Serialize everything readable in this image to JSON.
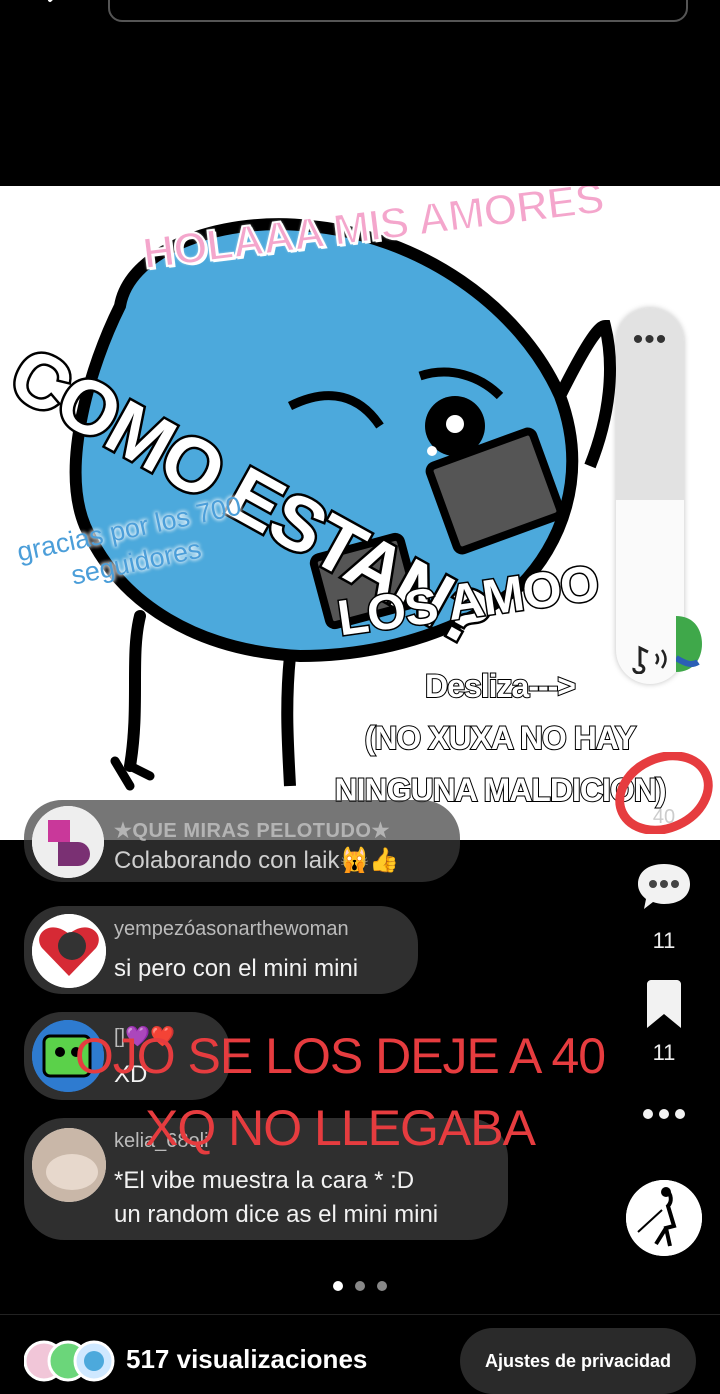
{
  "header": {
    "search_placeholder": ""
  },
  "post": {
    "overlay_hola": "HOLAAA MIS AMORES",
    "overlay_como": "COMO ESTAN?",
    "overlay_gracias": "gracias por los 700\nseguidores",
    "overlay_amoo": "LOS AMOO",
    "overlay_desliza": "Desliza--->\n(NO XUXA NO HAY\nNINGUNA MALDICION)"
  },
  "volume": {
    "level_percent": 49
  },
  "comments": [
    {
      "user": "★QUE MIRAS PELOTUDO★",
      "text": "Colaborando con laik🙀👍"
    },
    {
      "user": "yempezóasonarthewoman",
      "text": "si pero con el mini mini"
    },
    {
      "user": "[]💜❤️",
      "text": "XD"
    },
    {
      "user": "kelia_68oli",
      "text": "*El vibe muestra la cara * :D\nun random dice as el mini mini"
    }
  ],
  "red_overlay": "OJO SE LOS DEJE A 40\nXQ NO LLEGABA",
  "actions": {
    "likes": "40",
    "comments": "11",
    "saves": "11"
  },
  "carousel": {
    "pages": 3,
    "current": 1
  },
  "footer": {
    "views": "517 visualizaciones",
    "privacy_button": "Ajustes de privacidad"
  },
  "colors": {
    "background": "#000000",
    "blob_blue": "#4ca9dc",
    "pink_text": "#f4a6cc",
    "red_annotation": "#e63c3f"
  }
}
